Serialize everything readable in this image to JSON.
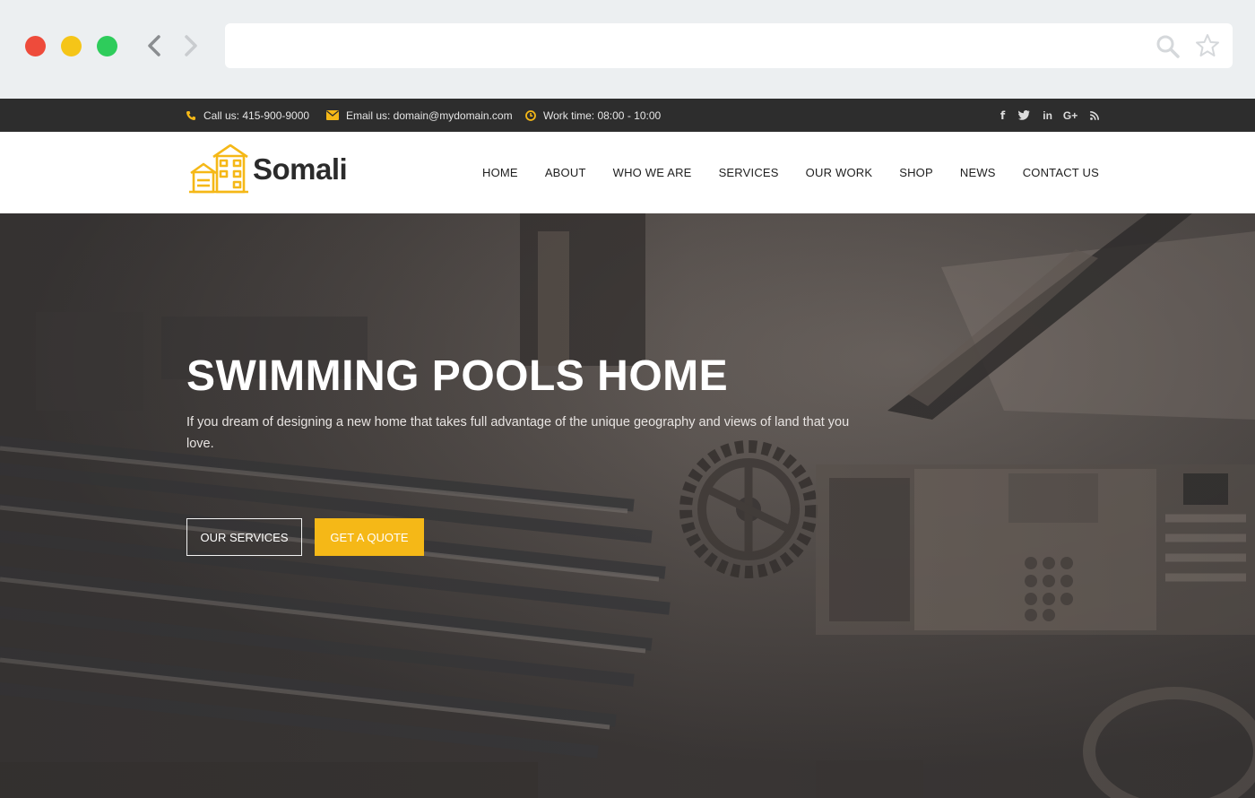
{
  "browser": {
    "address_value": "",
    "icons": [
      "back-arrow-icon",
      "forward-arrow-icon",
      "search-icon",
      "star-icon"
    ]
  },
  "topbar": {
    "phone": "Call us: 415-900-9000",
    "email": "Email us: domain@mydomain.com",
    "worktime": "Work time: 08:00 - 10:00",
    "social": {
      "facebook": "f",
      "twitter": "t",
      "linkedin": "in",
      "googleplus": "G+",
      "rss": "rss"
    }
  },
  "header": {
    "logo_text": "Somali",
    "menu": [
      "HOME",
      "ABOUT",
      "WHO WE ARE",
      "SERVICES",
      "OUR WORK",
      "SHOP",
      "NEWS",
      "CONTACT US"
    ]
  },
  "hero": {
    "title": "SWIMMING POOLS HOME",
    "text": "If you dream of designing a new home that takes full advantage of the unique geography and views of land that you love.",
    "btn_services": "OUR SERVICES",
    "btn_quote": "GET A QUOTE"
  },
  "colors": {
    "accent": "#f5b817",
    "topbar_bg": "#2d2d2d",
    "chrome_bg": "#eceff1"
  }
}
